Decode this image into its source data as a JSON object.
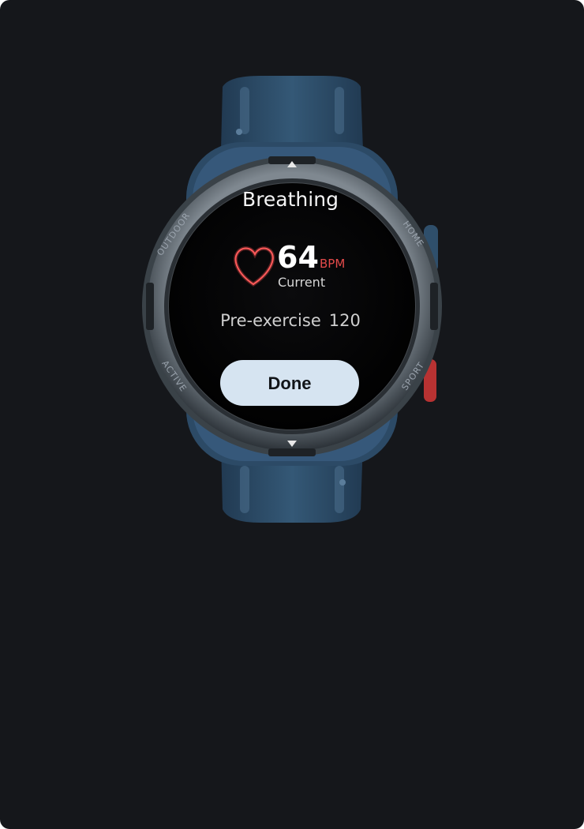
{
  "app": {
    "title": "Breathing"
  },
  "heart_rate": {
    "value": "64",
    "unit": "BPM",
    "caption": "Current"
  },
  "pre_exercise": {
    "label": "Pre-exercise",
    "value": "120"
  },
  "actions": {
    "done_label": "Done"
  },
  "bezel_labels": {
    "top_left": "OUTDOOR",
    "top_right": "HOME",
    "bottom_left": "ACTIVE",
    "bottom_right": "SPORT"
  },
  "colors": {
    "background": "#15171b",
    "strap": "#2f4f6b",
    "accent_heart": "#e34a4a",
    "button_bg": "#d6e4f1"
  },
  "icons": {
    "heart": "heart-outline-icon",
    "bezel_up": "triangle-up-icon",
    "bezel_down": "triangle-down-icon"
  }
}
